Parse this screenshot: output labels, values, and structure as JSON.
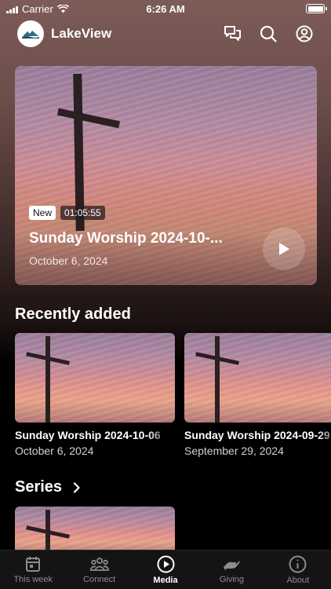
{
  "status_bar": {
    "carrier": "Carrier",
    "time": "6:26 AM"
  },
  "header": {
    "app_name": "LakeView",
    "icons": [
      "chat-icon",
      "search-icon",
      "profile-icon"
    ]
  },
  "hero": {
    "badge": "New",
    "duration": "01:05:55",
    "title": "Sunday Worship 2024-10-...",
    "date": "October 6, 2024"
  },
  "recently_added": {
    "title": "Recently added",
    "items": [
      {
        "title": "Sunday Worship 2024-10-06",
        "date": "October 6, 2024"
      },
      {
        "title": "Sunday Worship 2024-09-29",
        "date": "September 29, 2024"
      }
    ]
  },
  "series": {
    "title": "Series"
  },
  "tab_bar": {
    "tabs": [
      {
        "label": "This week",
        "icon": "calendar-icon"
      },
      {
        "label": "Connect",
        "icon": "people-icon"
      },
      {
        "label": "Media",
        "icon": "play-circle-icon",
        "active": true
      },
      {
        "label": "Giving",
        "icon": "hand-icon"
      },
      {
        "label": "About",
        "icon": "info-icon"
      }
    ]
  },
  "colors": {
    "background": "#000000",
    "tab_active": "#ffffff",
    "tab_inactive": "#8c8c8c"
  }
}
